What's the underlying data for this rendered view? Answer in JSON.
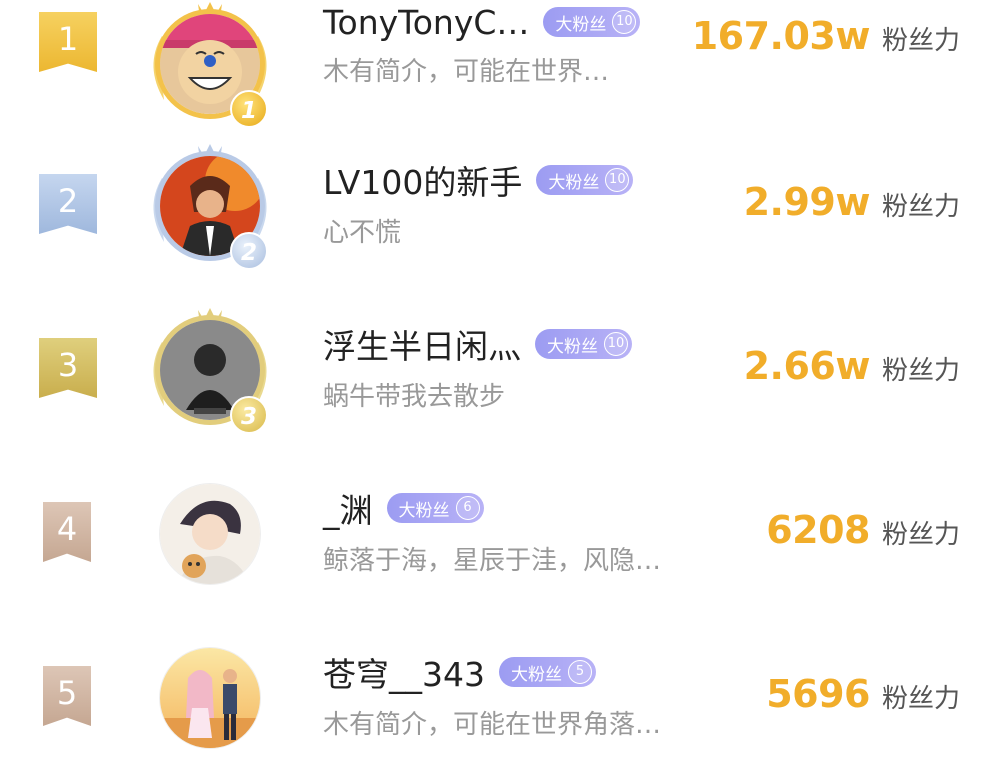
{
  "colors": {
    "accent_gold": "#f1ad2a",
    "badge_purple": "#a49df3",
    "text_primary": "#222222",
    "text_secondary": "#999999"
  },
  "ranking": [
    {
      "rank": "1",
      "name": "TonyTonyC…",
      "badge_label": "大粉丝",
      "badge_level": "10",
      "bio": "木有简介，可能在世界…",
      "score": "167.03w",
      "score_unit": "粉丝力",
      "avatar_icon": "cartoon-character-avatar",
      "medal_icon": "gold-medal-icon"
    },
    {
      "rank": "2",
      "name": "LV100的新手",
      "badge_label": "大粉丝",
      "badge_level": "10",
      "bio": "心不慌",
      "score": "2.99w",
      "score_unit": "粉丝力",
      "avatar_icon": "anime-character-avatar",
      "medal_icon": "silver-medal-icon"
    },
    {
      "rank": "3",
      "name": "浮生半日闲灬",
      "badge_label": "大粉丝",
      "badge_level": "10",
      "bio": "蜗牛带我去散步",
      "score": "2.66w",
      "score_unit": "粉丝力",
      "avatar_icon": "dark-figure-avatar",
      "medal_icon": "bronze-medal-icon"
    },
    {
      "rank": "4",
      "name": "_渊",
      "badge_label": "大粉丝",
      "badge_level": "6",
      "bio": "鲸落于海，星辰于洼，风隐…",
      "score": "6208",
      "score_unit": "粉丝力",
      "avatar_icon": "anime-boy-with-cat-avatar"
    },
    {
      "rank": "5",
      "name": "苍穹__343",
      "badge_label": "大粉丝",
      "badge_level": "5",
      "bio": "木有简介，可能在世界角落…",
      "score": "5696",
      "score_unit": "粉丝力",
      "avatar_icon": "couple-sunset-avatar"
    }
  ]
}
